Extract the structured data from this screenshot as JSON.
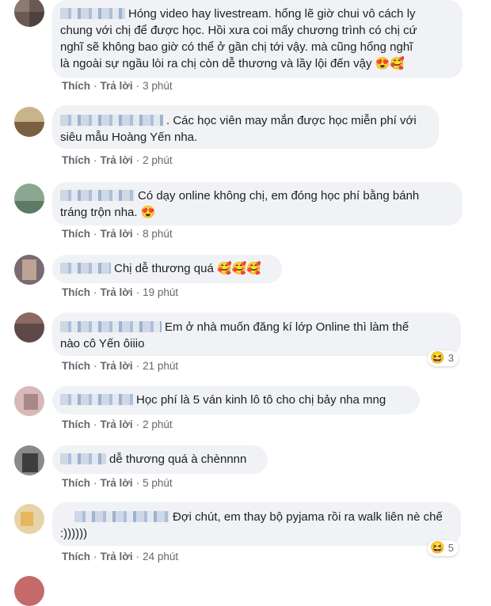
{
  "actions": {
    "like": "Thích",
    "reply": "Trả lời",
    "sep": "·"
  },
  "comments": [
    {
      "text_lines": [
        "Hóng video hay livestream. hổng lẽ giờ chui vô cách ly",
        "chung với chị để được học. Hồi xưa coi mấy chương trình có chị cứ",
        "nghĩ sẽ không bao giờ có thể ở gần chị tới vậy. mà cũng hổng nghĩ",
        "là ngoài sự ngầu lòi ra chị còn dễ thương và lầy lội đến vậy 😍🥰"
      ],
      "time": "3 phút"
    },
    {
      "text_lines": ". Các học viên may mắn được học miễn phí với\nsiêu mẫu Hoàng Yến nha.",
      "time": "2 phút"
    },
    {
      "text_lines": "Có dạy online không chị, em đóng học phí bằng bánh\ntráng trộn nha. 😍",
      "time": "8 phút"
    },
    {
      "text_lines": "Chị dễ thương quá 🥰🥰🥰",
      "time": "19 phút"
    },
    {
      "text_lines": "Em ở nhà muốn đăng kí lớp Online thì làm thế\nnào cô Yến ôiiio",
      "time": "21 phút",
      "reaction": {
        "icon": "😆",
        "count": "3"
      }
    },
    {
      "text_lines": "Học phí là 5 ván kinh lô tô cho chị bảy nha mng",
      "time": "2 phút"
    },
    {
      "text_lines": "dễ thương quá à chènnnn",
      "time": "5 phút"
    },
    {
      "text_lines": "Đợi chút, em thay bộ pyjama rồi ra walk liên nè chế\n:))))))",
      "time": "24 phút",
      "reaction": {
        "icon": "😆",
        "count": "5"
      }
    }
  ]
}
